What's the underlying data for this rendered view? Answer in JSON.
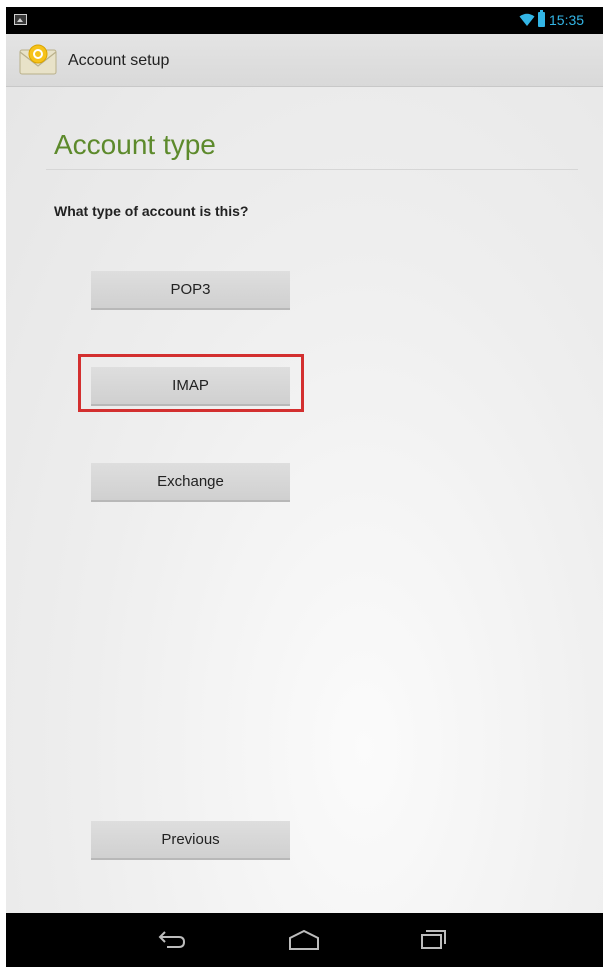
{
  "status_bar": {
    "time": "15:35",
    "icons": [
      "notification-icon",
      "wifi-icon",
      "battery-icon"
    ]
  },
  "action_bar": {
    "title": "Account setup",
    "app_icon": "email-app-icon"
  },
  "main": {
    "page_title": "Account type",
    "prompt": "What type of account is this?",
    "options": {
      "pop3": "POP3",
      "imap": "IMAP",
      "exchange": "Exchange"
    },
    "highlighted_option": "IMAP",
    "previous_label": "Previous"
  },
  "nav_bar": {
    "icons": [
      "back-icon",
      "home-icon",
      "recents-icon"
    ]
  },
  "colors": {
    "title_green": "#5d8a2c",
    "status_blue": "#33b5e5",
    "highlight_red": "#d32f2f"
  }
}
